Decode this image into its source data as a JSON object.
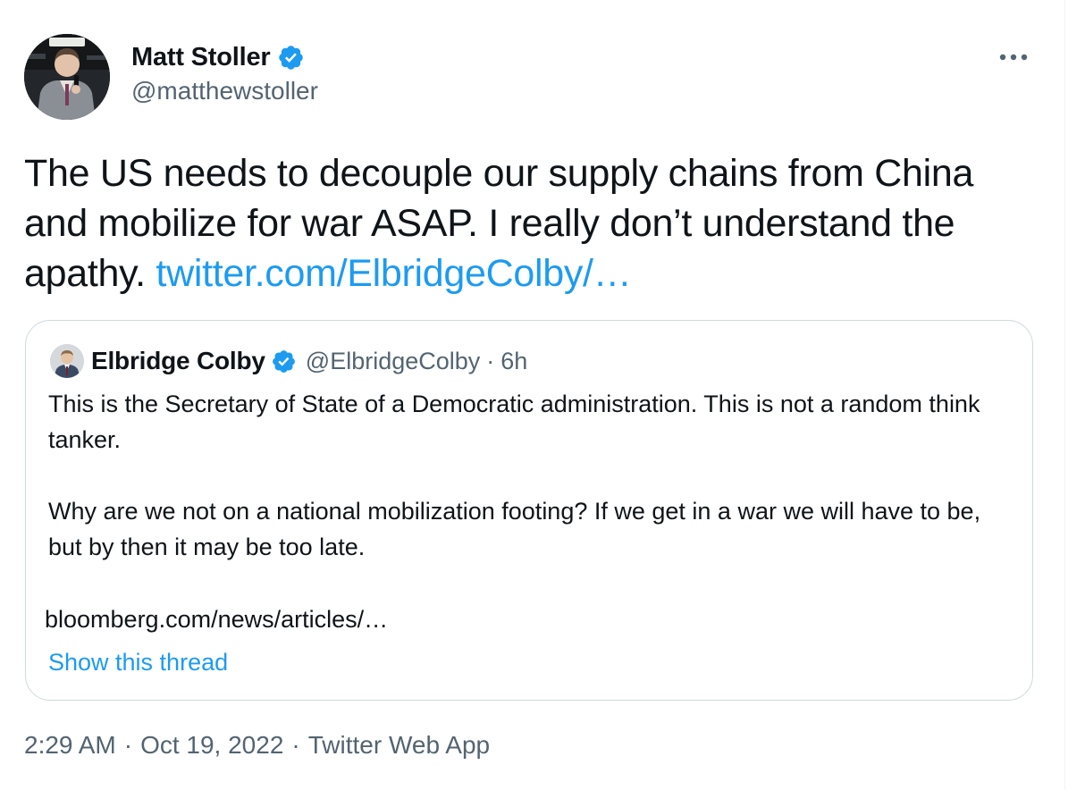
{
  "tweet": {
    "author": {
      "display_name": "Matt Stoller",
      "handle": "@matthewstoller",
      "verified": true,
      "avatar_icon": "person-speaking-avatar"
    },
    "more_icon": "more-horizontal-icon",
    "text": "The US needs to decouple our supply chains from China and mobilize for war ASAP. I really don’t understand the apathy.",
    "link": "twitter.com/ElbridgeColby/…",
    "time": "2:29 AM",
    "date": "Oct 19, 2022",
    "separator": "·",
    "source": "Twitter Web App"
  },
  "quote": {
    "author": {
      "display_name": "Elbridge Colby",
      "handle": "@ElbridgeColby",
      "verified": true,
      "avatar_icon": "person-avatar"
    },
    "separator": "·",
    "age": "6h",
    "text": "This is the Secretary of State of a Democratic administration. This is not a random think tanker.\n\nWhy are we not on a national mobilization footing? If we get in a war we will have to be, but by then it may be too late.",
    "link": "bloomberg.com/news/articles/…",
    "show_thread": "Show this thread"
  },
  "colors": {
    "accent": "#1d9bf0",
    "text": "#0f1419",
    "secondary": "#536471",
    "border": "#cfd9de"
  }
}
